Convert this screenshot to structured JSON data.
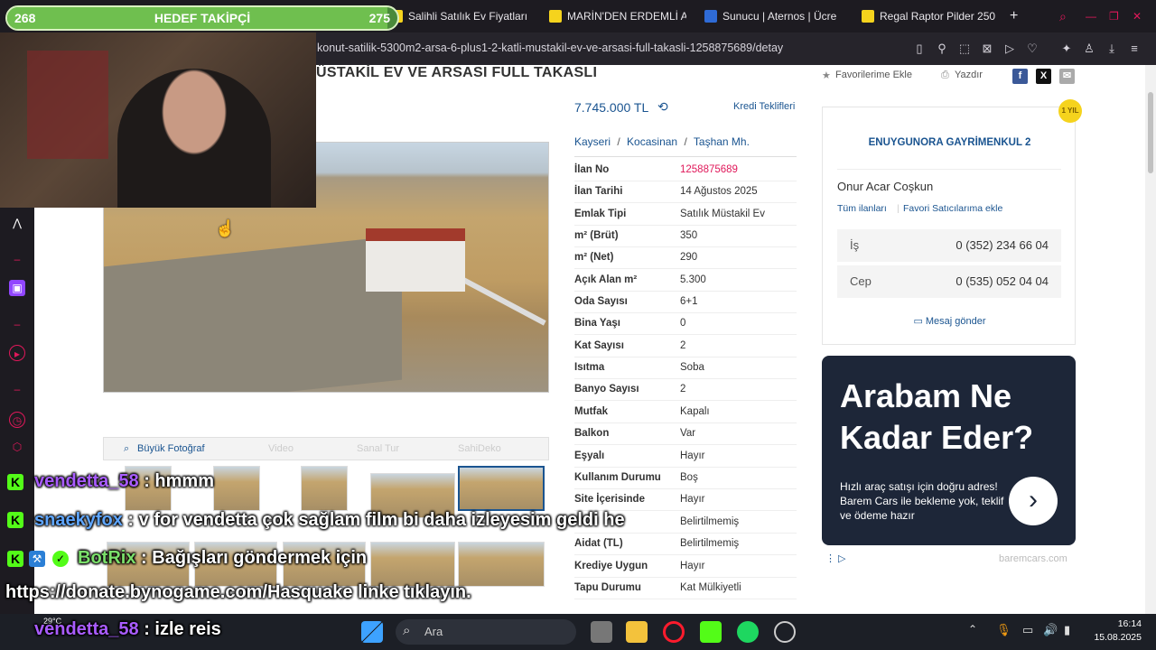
{
  "stream": {
    "goal_current": "268",
    "goal_title": "HEDEF TAKİPÇİ",
    "goal_target": "275",
    "goal_progress": 0.974
  },
  "browser": {
    "tabs": [
      {
        "label": "Salihli Satılık Ev Fiyatları",
        "icon": "sahibinden-icon",
        "color": "#f5d31d"
      },
      {
        "label": "MARİN'DEN ERDEMLİ Aİ",
        "icon": "sahibinden-icon",
        "color": "#f5d31d"
      },
      {
        "label": "Sunucu | Aternos | Ücre",
        "icon": "aternos-icon",
        "color": "#2f6bd6"
      },
      {
        "label": "Regal Raptor Pilder 250",
        "icon": "sahibinden-icon",
        "color": "#f5d31d"
      }
    ],
    "new_tab": "+",
    "url": "konut-satilik-5300m2-arsa-6-plus1-2-katli-mustakil-ev-ve-arsasi-full-takasli-1258875689/detay"
  },
  "listing": {
    "title": "ÜSTAKİL EV VE ARSASI FULL TAKASLI",
    "favorite_label": "Favorilerime Ekle",
    "print_label": "Yazdır",
    "price": "7.745.000 TL",
    "credit_label": "Kredi Teklifleri",
    "location": [
      "Kayseri",
      "Kocasinan",
      "Taşhan Mh."
    ],
    "location_sep": "/",
    "photo_tabs": [
      "Büyük Fotoğraf",
      "Video",
      "Sanal Tur",
      "SahiDeko"
    ],
    "details": [
      {
        "key": "İlan No",
        "value": "1258875689",
        "highlight": true
      },
      {
        "key": "İlan Tarihi",
        "value": "14 Ağustos 2025"
      },
      {
        "key": "Emlak Tipi",
        "value": "Satılık Müstakil Ev"
      },
      {
        "key": "m² (Brüt)",
        "value": "350"
      },
      {
        "key": "m² (Net)",
        "value": "290"
      },
      {
        "key": "Açık Alan m²",
        "value": "5.300"
      },
      {
        "key": "Oda Sayısı",
        "value": "6+1"
      },
      {
        "key": "Bina Yaşı",
        "value": "0"
      },
      {
        "key": "Kat Sayısı",
        "value": "2"
      },
      {
        "key": "Isıtma",
        "value": "Soba"
      },
      {
        "key": "Banyo Sayısı",
        "value": "2"
      },
      {
        "key": "Mutfak",
        "value": "Kapalı"
      },
      {
        "key": "Balkon",
        "value": "Var"
      },
      {
        "key": "Eşyalı",
        "value": "Hayır"
      },
      {
        "key": "Kullanım Durumu",
        "value": "Boş"
      },
      {
        "key": "Site İçerisinde",
        "value": "Hayır"
      },
      {
        "key": "",
        "value": "Belirtilmemiş"
      },
      {
        "key": "Aidat (TL)",
        "value": "Belirtilmemiş"
      },
      {
        "key": "Krediye Uygun",
        "value": "Hayır"
      },
      {
        "key": "Tapu Durumu",
        "value": "Kat Mülkiyetli"
      }
    ]
  },
  "seller": {
    "agency": "ENUYGUNORA GAYRİMENKUL 2",
    "name": "Onur Acar Coşkun",
    "all_listings": "Tüm ilanları",
    "favorite_sellers": "Favori Satıcılarıma ekle",
    "phones": [
      {
        "label": "İş",
        "value": "0 (352) 234 66 04"
      },
      {
        "label": "Cep",
        "value": "0 (535) 052 04 04"
      }
    ],
    "message": "Mesaj gönder",
    "badge": "1 YIL"
  },
  "ad": {
    "headline": "Arabam Ne Kadar Eder?",
    "body": "Hızlı araç satışı için doğru adres! Barem Cars ile bekleme yok, teklif ve ödeme hazır",
    "domain": "baremcars.com"
  },
  "chat": [
    {
      "user": "vendetta_58",
      "sep": ":",
      "text": "hmmm"
    },
    {
      "user": "snaekyfox",
      "sep": ":",
      "text": "v for vendetta çok sağlam film bi daha izleyesim geldi he"
    },
    {
      "user": "BotRix",
      "sep": ":",
      "text": "Bağışları göndermek için"
    },
    {
      "user": "",
      "sep": "",
      "text": "https://donate.bynogame.com/Hasquake linke tıklayın."
    },
    {
      "user": "vendetta_58",
      "sep": ":",
      "text": "izle reis"
    }
  ],
  "taskbar": {
    "search_placeholder": "Ara",
    "weather": "29°C",
    "time": "16:14",
    "date": "15.08.2025"
  }
}
